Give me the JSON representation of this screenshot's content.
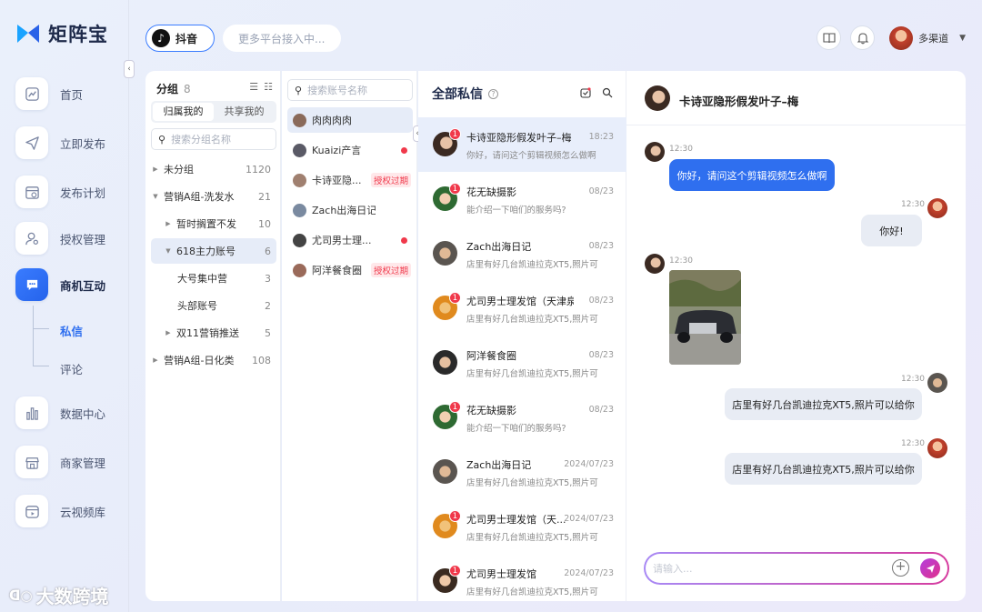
{
  "brand": {
    "name": "矩阵宝"
  },
  "sidebar": {
    "items": [
      {
        "label": "首页",
        "icon": "chart-line-icon"
      },
      {
        "label": "立即发布",
        "icon": "send-icon"
      },
      {
        "label": "发布计划",
        "icon": "calendar-icon"
      },
      {
        "label": "授权管理",
        "icon": "user-key-icon"
      },
      {
        "label": "商机互动",
        "icon": "chat-icon"
      },
      {
        "label": "数据中心",
        "icon": "bar-chart-icon"
      },
      {
        "label": "商家管理",
        "icon": "store-icon"
      },
      {
        "label": "云视频库",
        "icon": "video-library-icon"
      }
    ],
    "sub_items": [
      {
        "label": "私信"
      },
      {
        "label": "评论"
      }
    ]
  },
  "topbar": {
    "platform": "抖音",
    "more_platforms": "更多平台接入中...",
    "user_name": "多渠道"
  },
  "groups": {
    "title": "分组",
    "count": "8",
    "tabs": [
      "归属我的",
      "共享我的"
    ],
    "search_placeholder": "搜索分组名称",
    "tree": [
      {
        "label": "未分组",
        "count": "1120"
      },
      {
        "label": "营销A组-洗发水",
        "count": "21"
      },
      {
        "label": "暂时搁置不发",
        "count": "10"
      },
      {
        "label": "618主力账号",
        "count": "6"
      },
      {
        "label": "大号集中营",
        "count": "3"
      },
      {
        "label": "头部账号",
        "count": "2"
      },
      {
        "label": "双11营销推送",
        "count": "5"
      },
      {
        "label": "营销A组-日化类",
        "count": "108"
      }
    ]
  },
  "accounts": {
    "search_placeholder": "搜索账号名称",
    "items": [
      {
        "name": "肉肉肉肉",
        "tag": ""
      },
      {
        "name": "Kuaizi产言",
        "tag": ""
      },
      {
        "name": "卡诗亚隐...",
        "tag": "授权过期"
      },
      {
        "name": "Zach出海日记",
        "tag": ""
      },
      {
        "name": "尤司男士理...",
        "tag": ""
      },
      {
        "name": "阿洋餐食圈",
        "tag": "授权过期"
      }
    ]
  },
  "messages": {
    "title": "全部私信",
    "items": [
      {
        "name": "卡诗亚隐形假发叶子–梅",
        "time": "18:23",
        "preview": "你好，请问这个剪辑视频怎么做啊",
        "badge": "1"
      },
      {
        "name": "花无缺摄影",
        "time": "08/23",
        "preview": "能介绍一下咱们的服务吗?",
        "badge": "1"
      },
      {
        "name": "Zach出海日记",
        "time": "08/23",
        "preview": "店里有好几台凯迪拉克XT5,照片可",
        "badge": ""
      },
      {
        "name": "尤司男士理发馆（天津泉",
        "time": "08/23",
        "preview": "店里有好几台凯迪拉克XT5,照片可",
        "badge": "1"
      },
      {
        "name": "阿洋餐食圈",
        "time": "08/23",
        "preview": "店里有好几台凯迪拉克XT5,照片可",
        "badge": ""
      },
      {
        "name": "花无缺摄影",
        "time": "08/23",
        "preview": "能介绍一下咱们的服务吗?",
        "badge": "1"
      },
      {
        "name": "Zach出海日记",
        "time": "2024/07/23",
        "preview": "店里有好几台凯迪拉克XT5,照片可",
        "badge": ""
      },
      {
        "name": "尤司男士理发馆（天...",
        "time": "2024/07/23",
        "preview": "店里有好几台凯迪拉克XT5,照片可",
        "badge": "1"
      },
      {
        "name": "尤司男士理发馆",
        "time": "2024/07/23",
        "preview": "店里有好几台凯迪拉克XT5,照片可",
        "badge": "1"
      }
    ]
  },
  "chat": {
    "title": "卡诗亚隐形假发叶子–梅",
    "msgs": [
      {
        "time": "12:30",
        "text": "你好，请问这个剪辑视频怎么做啊"
      },
      {
        "time": "12:30",
        "text": "你好!"
      },
      {
        "time": "12:30",
        "text": ""
      },
      {
        "time": "12:30",
        "text": "店里有好几台凯迪拉克XT5,照片可以给你"
      },
      {
        "time": "12:30",
        "text": "店里有好几台凯迪拉克XT5,照片可以给你"
      }
    ],
    "input_placeholder": "请输入..."
  },
  "watermark": "大数跨境",
  "colors": {
    "accent": "#2f6fef",
    "badge": "#f0394b"
  }
}
